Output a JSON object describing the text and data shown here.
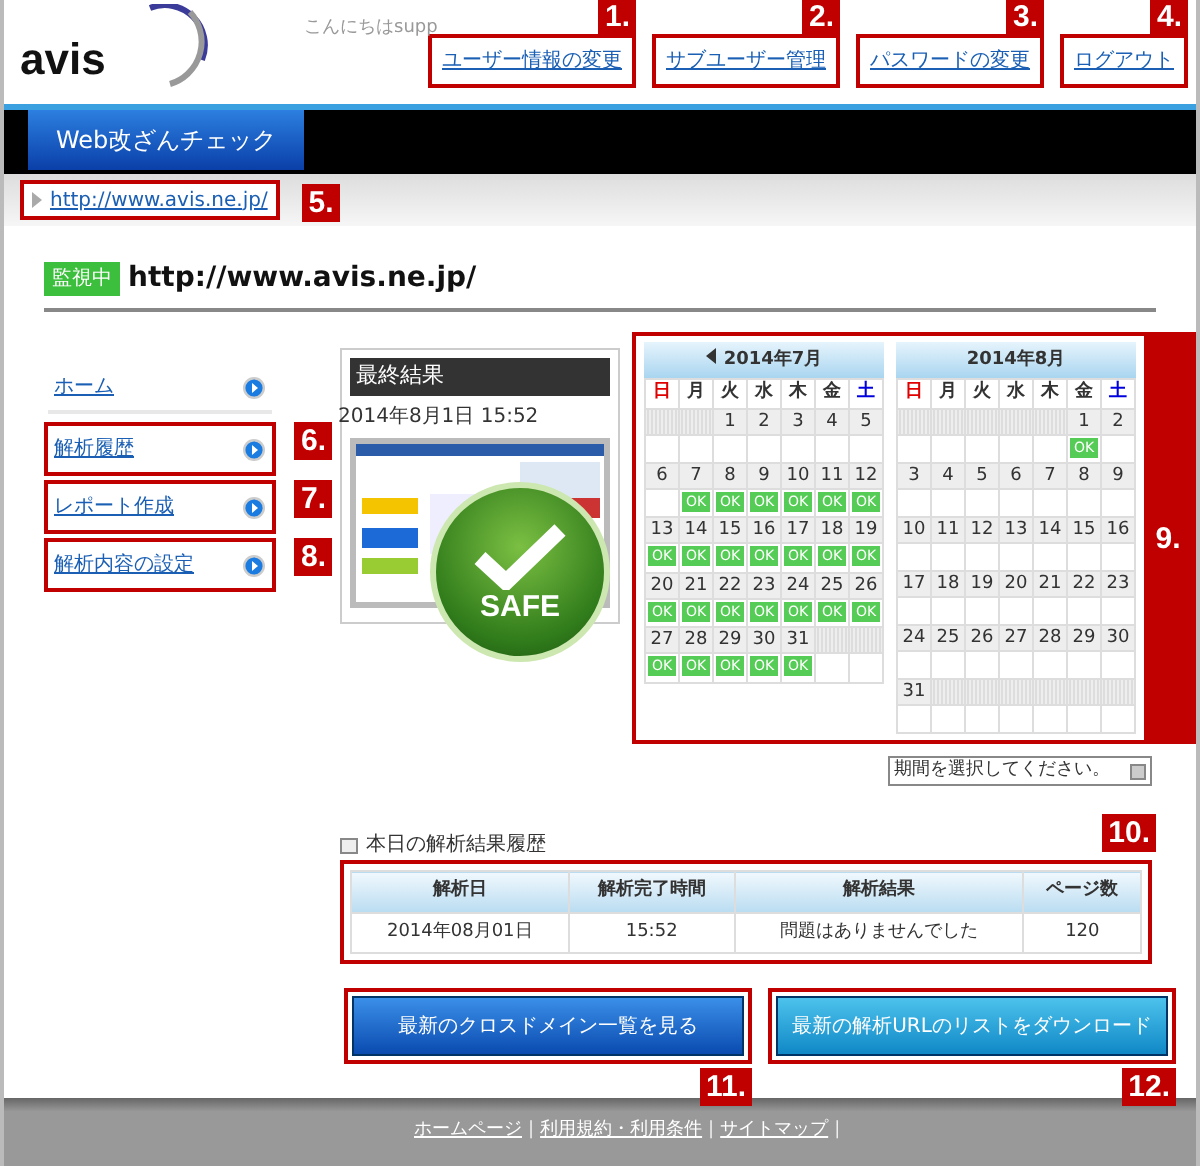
{
  "header": {
    "logo": "avis",
    "greeting": "こんにちはsupp",
    "links": [
      {
        "label": "ユーザー情報の変更",
        "callout": "1."
      },
      {
        "label": "サブユーザー管理",
        "callout": "2."
      },
      {
        "label": "パスワードの変更",
        "callout": "3."
      },
      {
        "label": "ログアウト",
        "callout": "4."
      }
    ]
  },
  "nav": {
    "tabs": [
      {
        "label": "Web改ざんチェック",
        "selected": true
      }
    ]
  },
  "breadcrumb": {
    "link": "http://www.avis.ne.jp/",
    "callout": "5."
  },
  "site": {
    "status": "監視中",
    "url": "http://www.avis.ne.jp/"
  },
  "sidebar": {
    "items": [
      {
        "label": "ホーム"
      },
      {
        "label": "解析履歴",
        "callout": "6."
      },
      {
        "label": "レポート作成",
        "callout": "7."
      },
      {
        "label": "解析内容の設定",
        "callout": "8."
      }
    ]
  },
  "result": {
    "title": "最終結果",
    "date": "2014年8月1日 15:52",
    "verdict": "SAFE"
  },
  "calendars": {
    "callout": "9.",
    "months": [
      {
        "title": "2014年7月",
        "prev": true,
        "weekdays": [
          {
            "label": "日",
            "color": "#e00000"
          },
          {
            "label": "月",
            "color": "#333333"
          },
          {
            "label": "火",
            "color": "#333333"
          },
          {
            "label": "水",
            "color": "#333333"
          },
          {
            "label": "木",
            "color": "#333333"
          },
          {
            "label": "金",
            "color": "#333333"
          },
          {
            "label": "土",
            "color": "#0000dd"
          }
        ],
        "weeks": [
          [
            {
              "kind": "blank"
            },
            {
              "kind": "blank"
            },
            {
              "kind": "day",
              "day": "1"
            },
            {
              "kind": "day",
              "day": "2"
            },
            {
              "kind": "day",
              "day": "3"
            },
            {
              "kind": "day",
              "day": "4"
            },
            {
              "kind": "day",
              "day": "5"
            }
          ],
          [
            {
              "kind": "day",
              "day": "6"
            },
            {
              "kind": "day",
              "day": "7",
              "badge": "OK"
            },
            {
              "kind": "day",
              "day": "8",
              "badge": "OK"
            },
            {
              "kind": "day",
              "day": "9",
              "badge": "OK"
            },
            {
              "kind": "day",
              "day": "10",
              "badge": "OK"
            },
            {
              "kind": "day",
              "day": "11",
              "badge": "OK"
            },
            {
              "kind": "day",
              "day": "12",
              "badge": "OK"
            }
          ],
          [
            {
              "kind": "day",
              "day": "13",
              "badge": "OK"
            },
            {
              "kind": "day",
              "day": "14",
              "badge": "OK"
            },
            {
              "kind": "day",
              "day": "15",
              "badge": "OK"
            },
            {
              "kind": "day",
              "day": "16",
              "badge": "OK"
            },
            {
              "kind": "day",
              "day": "17",
              "badge": "OK"
            },
            {
              "kind": "day",
              "day": "18",
              "badge": "OK"
            },
            {
              "kind": "day",
              "day": "19",
              "badge": "OK"
            }
          ],
          [
            {
              "kind": "day",
              "day": "20",
              "badge": "OK"
            },
            {
              "kind": "day",
              "day": "21",
              "badge": "OK"
            },
            {
              "kind": "day",
              "day": "22",
              "badge": "OK"
            },
            {
              "kind": "day",
              "day": "23",
              "badge": "OK"
            },
            {
              "kind": "day",
              "day": "24",
              "badge": "OK"
            },
            {
              "kind": "day",
              "day": "25",
              "badge": "OK"
            },
            {
              "kind": "day",
              "day": "26",
              "badge": "OK"
            }
          ],
          [
            {
              "kind": "day",
              "day": "27",
              "badge": "OK"
            },
            {
              "kind": "day",
              "day": "28",
              "badge": "OK"
            },
            {
              "kind": "day",
              "day": "29",
              "badge": "OK"
            },
            {
              "kind": "day",
              "day": "30",
              "badge": "OK"
            },
            {
              "kind": "day",
              "day": "31",
              "badge": "OK"
            },
            {
              "kind": "blank"
            },
            {
              "kind": "blank"
            }
          ]
        ]
      },
      {
        "title": "2014年8月",
        "prev": false,
        "weekdays": [
          {
            "label": "日",
            "color": "#e00000"
          },
          {
            "label": "月",
            "color": "#333333"
          },
          {
            "label": "火",
            "color": "#333333"
          },
          {
            "label": "水",
            "color": "#333333"
          },
          {
            "label": "木",
            "color": "#333333"
          },
          {
            "label": "金",
            "color": "#333333"
          },
          {
            "label": "土",
            "color": "#0000dd"
          }
        ],
        "weeks": [
          [
            {
              "kind": "blank"
            },
            {
              "kind": "blank"
            },
            {
              "kind": "blank"
            },
            {
              "kind": "blank"
            },
            {
              "kind": "blank"
            },
            {
              "kind": "day",
              "day": "1",
              "badge": "OK"
            },
            {
              "kind": "day",
              "day": "2"
            }
          ],
          [
            {
              "kind": "day",
              "day": "3"
            },
            {
              "kind": "day",
              "day": "4"
            },
            {
              "kind": "day",
              "day": "5"
            },
            {
              "kind": "day",
              "day": "6"
            },
            {
              "kind": "day",
              "day": "7"
            },
            {
              "kind": "day",
              "day": "8"
            },
            {
              "kind": "day",
              "day": "9"
            }
          ],
          [
            {
              "kind": "day",
              "day": "10"
            },
            {
              "kind": "day",
              "day": "11"
            },
            {
              "kind": "day",
              "day": "12"
            },
            {
              "kind": "day",
              "day": "13"
            },
            {
              "kind": "day",
              "day": "14"
            },
            {
              "kind": "day",
              "day": "15"
            },
            {
              "kind": "day",
              "day": "16"
            }
          ],
          [
            {
              "kind": "day",
              "day": "17"
            },
            {
              "kind": "day",
              "day": "18"
            },
            {
              "kind": "day",
              "day": "19"
            },
            {
              "kind": "day",
              "day": "20"
            },
            {
              "kind": "day",
              "day": "21"
            },
            {
              "kind": "day",
              "day": "22"
            },
            {
              "kind": "day",
              "day": "23"
            }
          ],
          [
            {
              "kind": "day",
              "day": "24"
            },
            {
              "kind": "day",
              "day": "25"
            },
            {
              "kind": "day",
              "day": "26"
            },
            {
              "kind": "day",
              "day": "27"
            },
            {
              "kind": "day",
              "day": "28"
            },
            {
              "kind": "day",
              "day": "29"
            },
            {
              "kind": "day",
              "day": "30"
            }
          ],
          [
            {
              "kind": "day",
              "day": "31"
            },
            {
              "kind": "blank"
            },
            {
              "kind": "blank"
            },
            {
              "kind": "blank"
            },
            {
              "kind": "blank"
            },
            {
              "kind": "blank"
            },
            {
              "kind": "blank"
            }
          ]
        ]
      }
    ]
  },
  "period_select": {
    "value": "期間を選択してください。"
  },
  "history": {
    "title": "本日の解析結果履歴",
    "callout": "10.",
    "columns": [
      "解析日",
      "解析完了時間",
      "解析結果",
      "ページ数"
    ],
    "rows": [
      [
        "2014年08月01日",
        "15:52",
        "問題はありませんでした",
        "120"
      ]
    ]
  },
  "buttons": [
    {
      "label": "最新のクロスドメイン一覧を見る",
      "kind": "dark",
      "callout": "11."
    },
    {
      "label": "最新の解析URLのリストをダウンロード",
      "kind": "light",
      "callout": "12."
    }
  ],
  "footer": {
    "links": [
      {
        "label": "ホームページ",
        "separator": "|"
      },
      {
        "label": "利用規約・利用条件",
        "separator": "|"
      },
      {
        "label": "サイトマップ",
        "separator": "|"
      }
    ]
  }
}
